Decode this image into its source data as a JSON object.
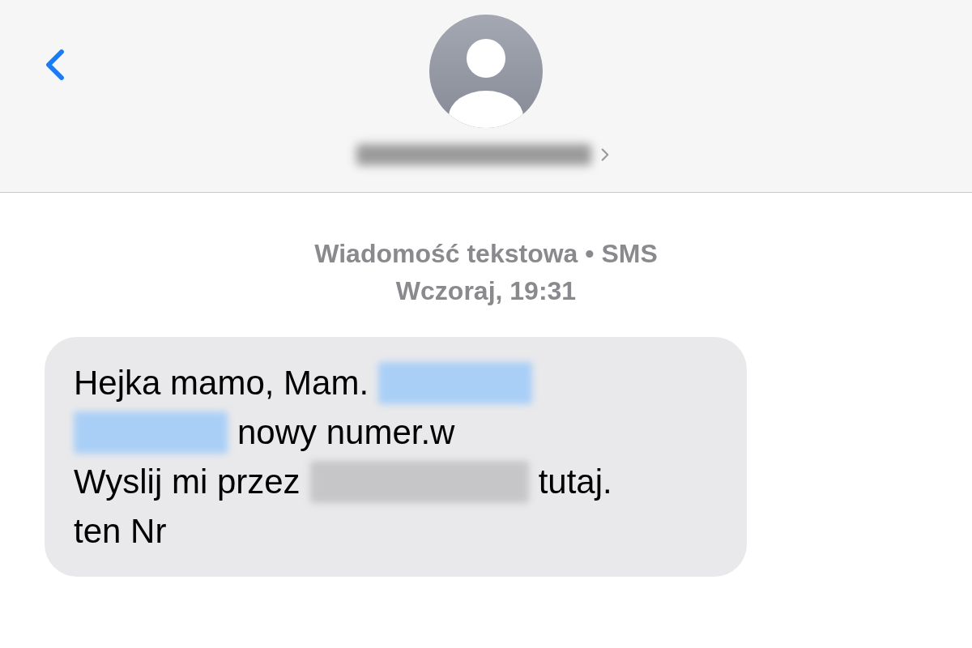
{
  "header": {
    "kind": "contact"
  },
  "conversation": {
    "service": "Wiadomość tekstowa • SMS",
    "timestamp": "Wczoraj, 19:31"
  },
  "message": {
    "lines": [
      [
        {
          "kind": "text",
          "text": "Hejka mamo, Mam."
        },
        {
          "kind": "redacted-link"
        }
      ],
      [
        {
          "kind": "redacted-link"
        },
        {
          "kind": "text",
          "text": "nowy numer.w"
        }
      ],
      [
        {
          "kind": "text",
          "text": "Wyslij mi przez"
        },
        {
          "kind": "redacted-text"
        },
        {
          "kind": "text",
          "text": "tutaj."
        }
      ],
      [
        {
          "kind": "text",
          "text": "ten Nr"
        }
      ]
    ]
  }
}
